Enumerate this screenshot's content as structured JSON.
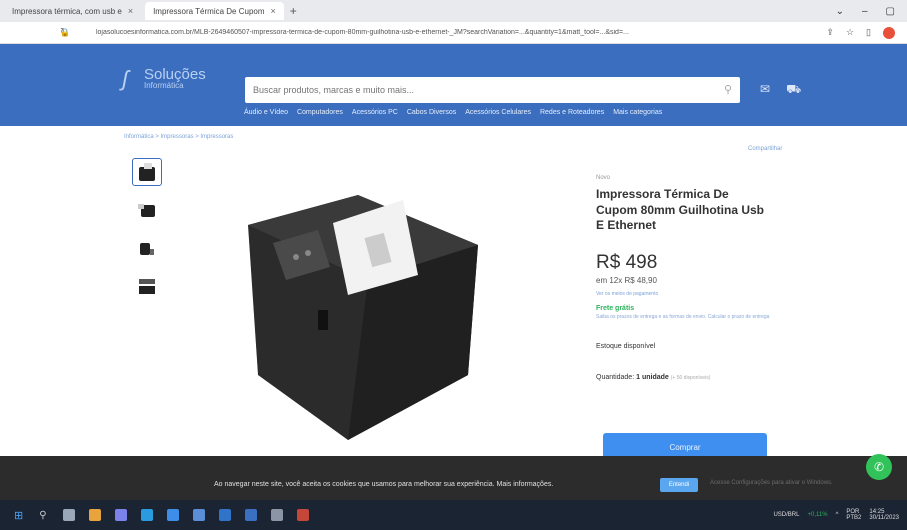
{
  "browser": {
    "tabs": [
      {
        "title": "Impressora térmica, com usb e",
        "active": false
      },
      {
        "title": "Impressora Térmica De Cupom",
        "active": true
      }
    ],
    "url": "lojasolucoesinformatica.com.br/MLB-2649460507-impressora-termica-de-cupom-80mm-guilhotina-usb-e-ethernet-_JM?searchVariation=...&quantity=1&matt_tool=...&sid=..."
  },
  "header": {
    "logo_name": "Soluções",
    "logo_sub": "Informática",
    "search_placeholder": "Buscar produtos, marcas e muito mais...",
    "categories": [
      "Áudio e Vídeo",
      "Computadores",
      "Acessórios PC",
      "Cabos Diversos",
      "Acessórios Celulares",
      "Redes e Roteadores",
      "Mais categorias"
    ]
  },
  "breadcrumb": "Informática > Impressoras > Impressoras",
  "share_label": "Compartilhar",
  "product": {
    "condition": "Novo",
    "title": "Impressora Térmica De Cupom 80mm Guilhotina Usb E Ethernet",
    "price": "R$ 498",
    "installments": "em 12x R$ 48,90",
    "payments_link": "Ver os meios de pagamento",
    "free_shipping": "Frete grátis",
    "shipping_note": "Saiba os prazos de entrega e as formas de envio. Calcular o prazo de entrega",
    "stock": "Estoque disponível",
    "quantity_label": "Quantidade:",
    "quantity_value": "1 unidade",
    "quantity_available": "(+ 50 disponíveis)",
    "buy_label": "Comprar"
  },
  "cookie": {
    "text": "Ao navegar neste site, você aceita os cookies que usamos para melhorar sua experiência. Mais informações.",
    "button": "Entendi",
    "right_text": "Acesse Configurações para ativar o Windows."
  },
  "taskbar": {
    "ticker": "USD/BRL",
    "ticker_change": "+0,11%",
    "lang": "POR",
    "layout": "PTB2",
    "time": "14:25",
    "date": "30/11/2023"
  }
}
